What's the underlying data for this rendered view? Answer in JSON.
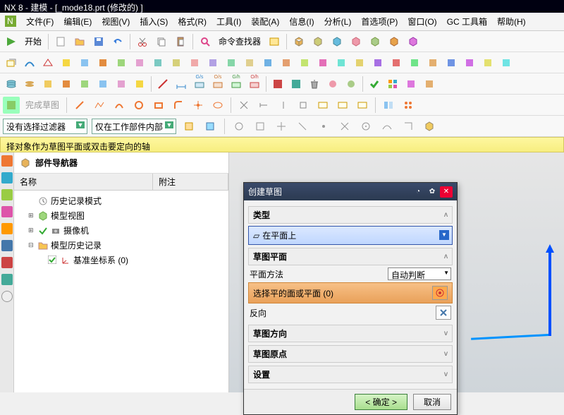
{
  "title": "NX 8 - 建模 - [_mode18.prt (修改的) ]",
  "menu": [
    "文件(F)",
    "编辑(E)",
    "视图(V)",
    "插入(S)",
    "格式(R)",
    "工具(I)",
    "装配(A)",
    "信息(I)",
    "分析(L)",
    "首选项(P)",
    "窗口(O)",
    "GC 工具箱",
    "帮助(H)"
  ],
  "start": "开始",
  "cmd_finder": "命令查找器",
  "finish_sketch": "完成草图",
  "filter": {
    "no_filter": "没有选择过滤器",
    "workpart": "仅在工作部件内部"
  },
  "statusmsg": "择对象作为草图平面或双击要定向的轴",
  "nav": {
    "title": "部件导航器",
    "col_name": "名称",
    "col_note": "附注",
    "nodes": {
      "history_mode": "历史记录模式",
      "model_view": "模型视图",
      "camera": "摄像机",
      "model_history": "模型历史记录",
      "datum": "基准坐标系 (0)"
    }
  },
  "dialog": {
    "title": "创建草图",
    "sect_type": "类型",
    "type_value": "在平面上",
    "sect_plane": "草图平面",
    "plane_method": "平面方法",
    "plane_method_value": "自动判断",
    "select_face": "选择平的面或平面 (0)",
    "reverse": "反向",
    "sect_orient": "草图方向",
    "sect_origin": "草图原点",
    "sect_settings": "设置",
    "ok": "< 确定 >",
    "cancel": "取消"
  }
}
